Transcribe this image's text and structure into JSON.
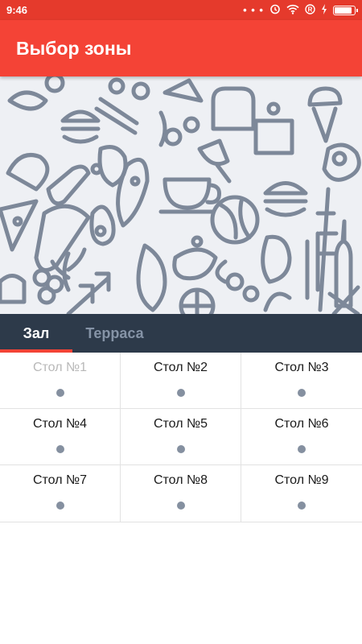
{
  "status_bar": {
    "time": "9:46",
    "dots": "• • •",
    "icons": [
      "alarm-icon",
      "wifi-icon",
      "r-badge-icon",
      "charging-icon",
      "battery-icon"
    ],
    "battery_level": 0.9
  },
  "app_bar": {
    "title": "Выбор зоны"
  },
  "banner": {
    "pattern": "food-doodle-pattern"
  },
  "tabs": [
    {
      "label": "Зал",
      "active": true
    },
    {
      "label": "Терраса",
      "active": false
    }
  ],
  "tables": [
    {
      "label": "Стол №1",
      "disabled": true
    },
    {
      "label": "Стол №2",
      "disabled": false
    },
    {
      "label": "Стол №3",
      "disabled": false
    },
    {
      "label": "Стол №4",
      "disabled": false
    },
    {
      "label": "Стол №5",
      "disabled": false
    },
    {
      "label": "Стол №6",
      "disabled": false
    },
    {
      "label": "Стол №7",
      "disabled": false
    },
    {
      "label": "Стол №8",
      "disabled": false
    },
    {
      "label": "Стол №9",
      "disabled": false
    }
  ],
  "colors": {
    "status_bar": "#e53a2c",
    "app_bar": "#f44336",
    "tabs_bg": "#2d3a4a",
    "tab_indicator": "#f44336",
    "doodle_stroke": "#7d8899",
    "dot": "#8590a0"
  }
}
